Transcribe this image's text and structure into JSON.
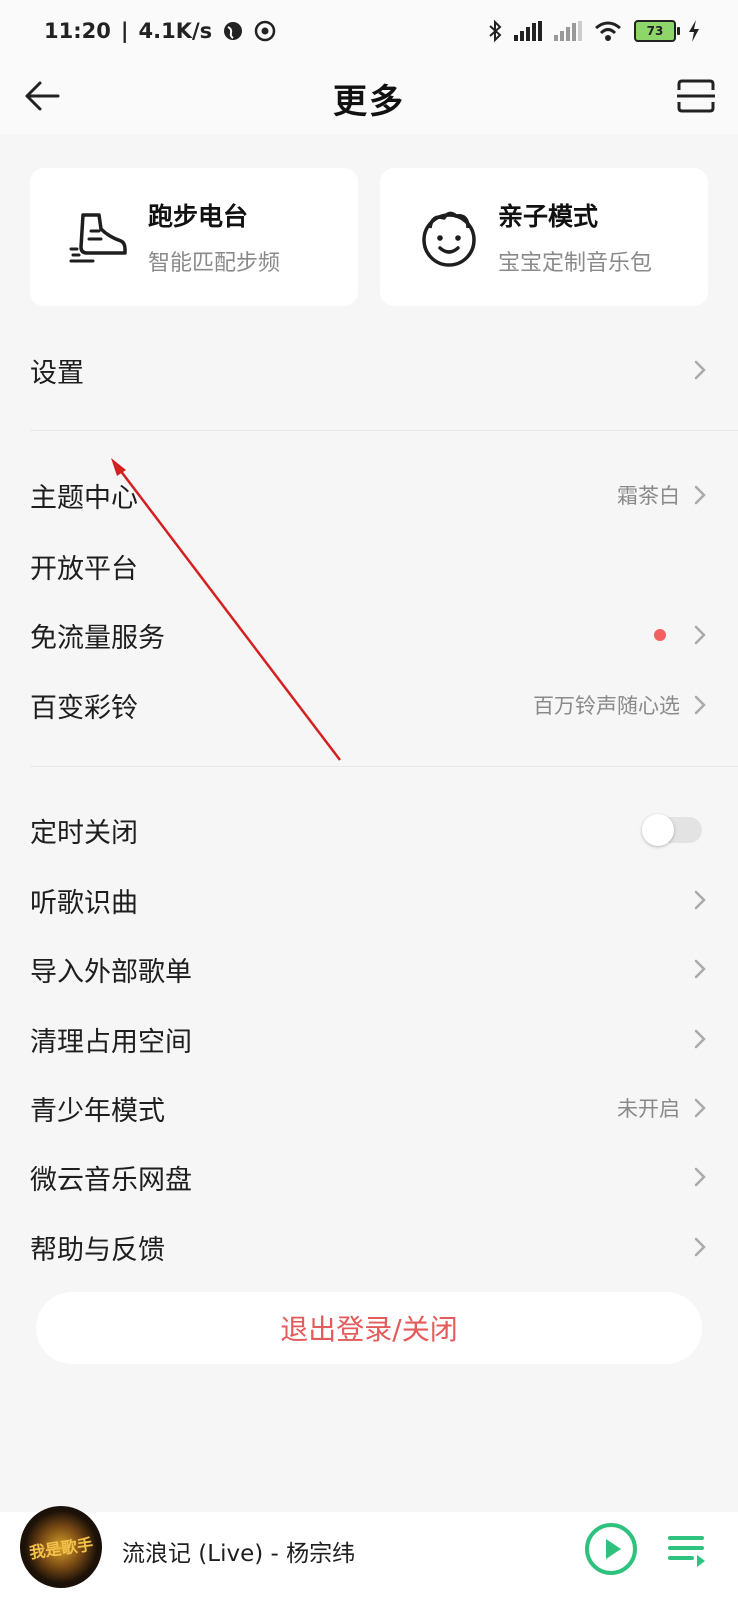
{
  "status_bar": {
    "time": "11:20",
    "speed": "4.1K/s",
    "battery": "73"
  },
  "header": {
    "title": "更多"
  },
  "cards": [
    {
      "title": "跑步电台",
      "subtitle": "智能匹配步频"
    },
    {
      "title": "亲子模式",
      "subtitle": "宝宝定制音乐包"
    }
  ],
  "group1": {
    "settings": {
      "label": "设置"
    }
  },
  "group2": [
    {
      "label": "主题中心",
      "value": "霜茶白"
    },
    {
      "label": "开放平台"
    },
    {
      "label": "免流量服务"
    },
    {
      "label": "百变彩铃",
      "value": "百万铃声随心选"
    }
  ],
  "group3": [
    {
      "label": "定时关闭",
      "toggle_on": false
    },
    {
      "label": "听歌识曲"
    },
    {
      "label": "导入外部歌单"
    },
    {
      "label": "清理占用空间"
    },
    {
      "label": "青少年模式",
      "value": "未开启"
    },
    {
      "label": "微云音乐网盘"
    },
    {
      "label": "帮助与反馈"
    }
  ],
  "logout_label": "退出登录/关闭",
  "player": {
    "song": "流浪记 (Live) - 杨宗纬",
    "album_art_text": "我是歌手"
  },
  "colors": {
    "accent_green": "#2ec27e",
    "logout_red": "#e35b5b",
    "dot_red": "#f26060",
    "annotation_red": "#d42020"
  }
}
